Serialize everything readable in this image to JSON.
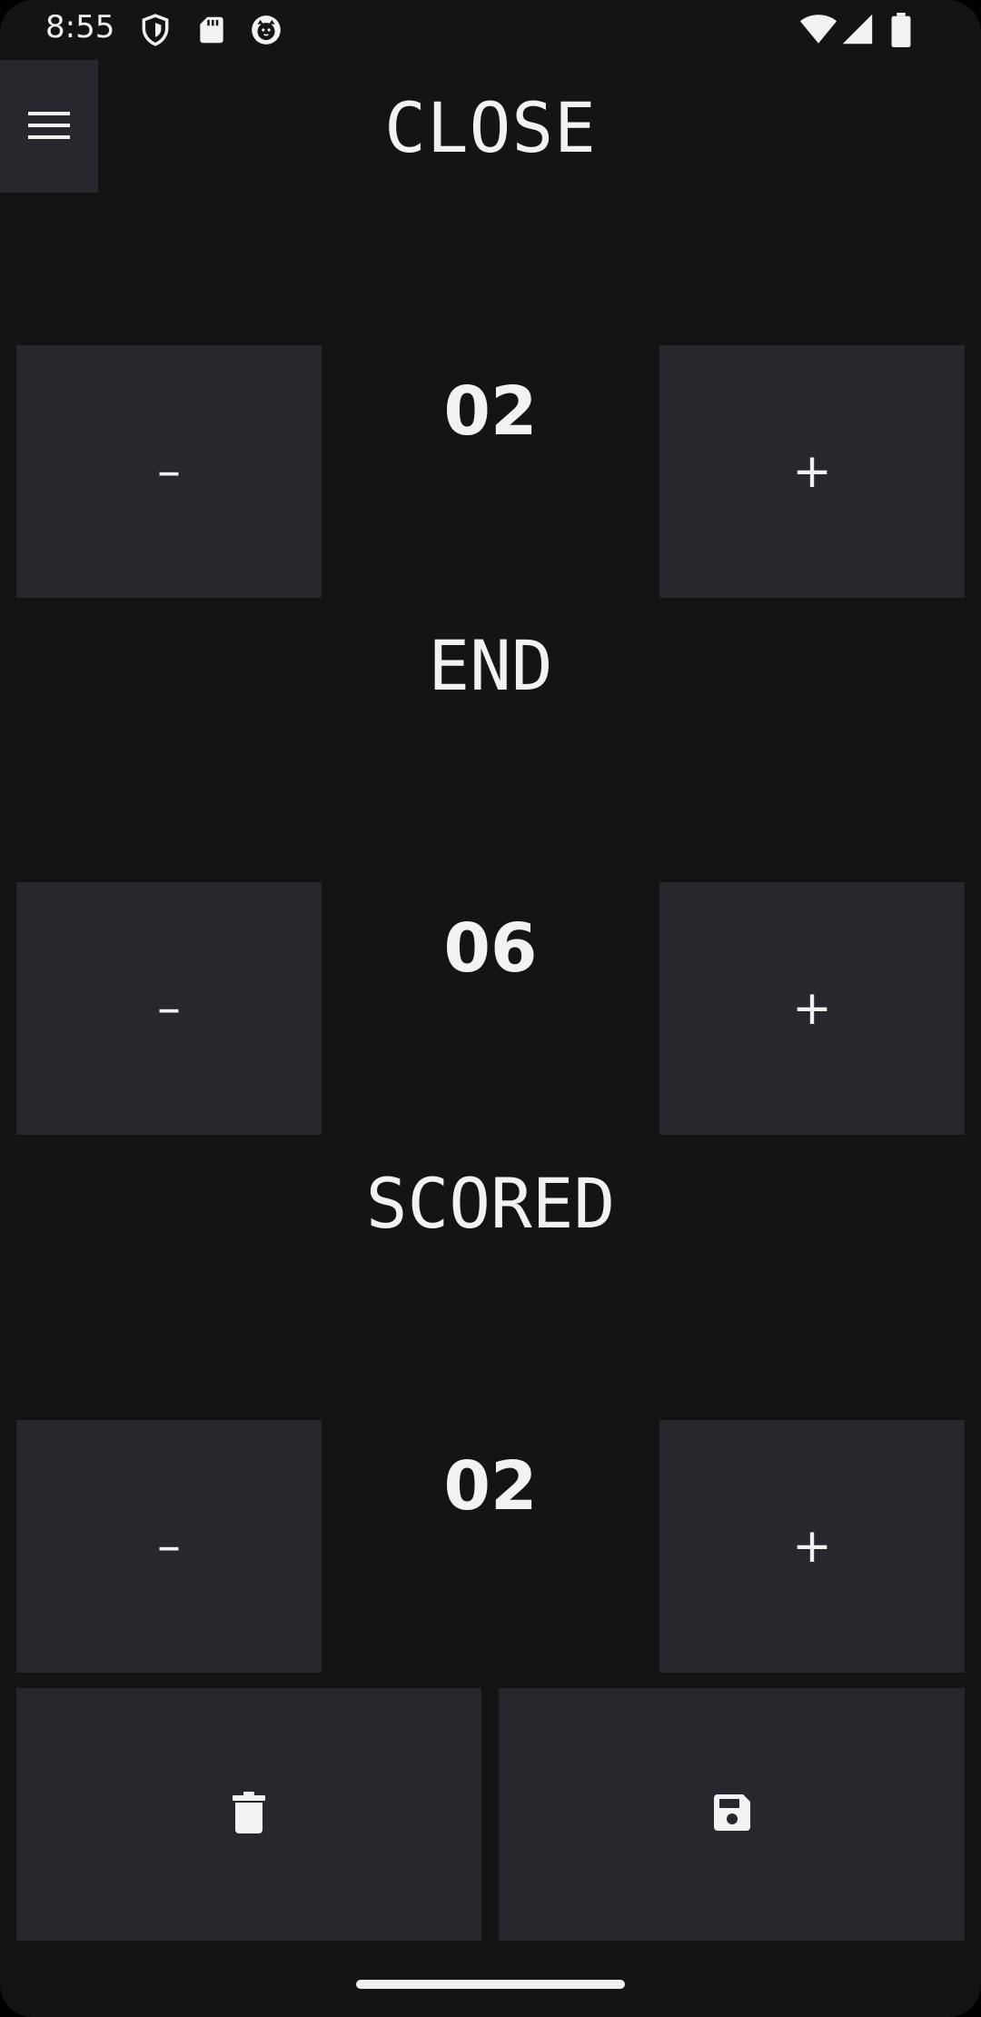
{
  "status_bar": {
    "time": "8:55",
    "icons_left": [
      "shield-icon",
      "sd-card-icon",
      "cat-face-icon"
    ],
    "icons_right": [
      "wifi-icon",
      "cell-signal-icon",
      "battery-icon"
    ]
  },
  "header": {
    "menu_icon": "hamburger-menu-icon",
    "title": "CLOSE"
  },
  "steppers": [
    {
      "value": "02",
      "minus_label": "–",
      "plus_label": "+"
    },
    {
      "value": "06",
      "minus_label": "–",
      "plus_label": "+"
    },
    {
      "value": "02",
      "minus_label": "–",
      "plus_label": "+"
    }
  ],
  "labels": {
    "end": "END",
    "scored": "SCORED"
  },
  "actions": {
    "delete_icon": "trash-icon",
    "save_icon": "floppy-disk-icon"
  },
  "colors": {
    "background": "#141414",
    "button": "#27282d",
    "text": "#f2f2f2"
  }
}
